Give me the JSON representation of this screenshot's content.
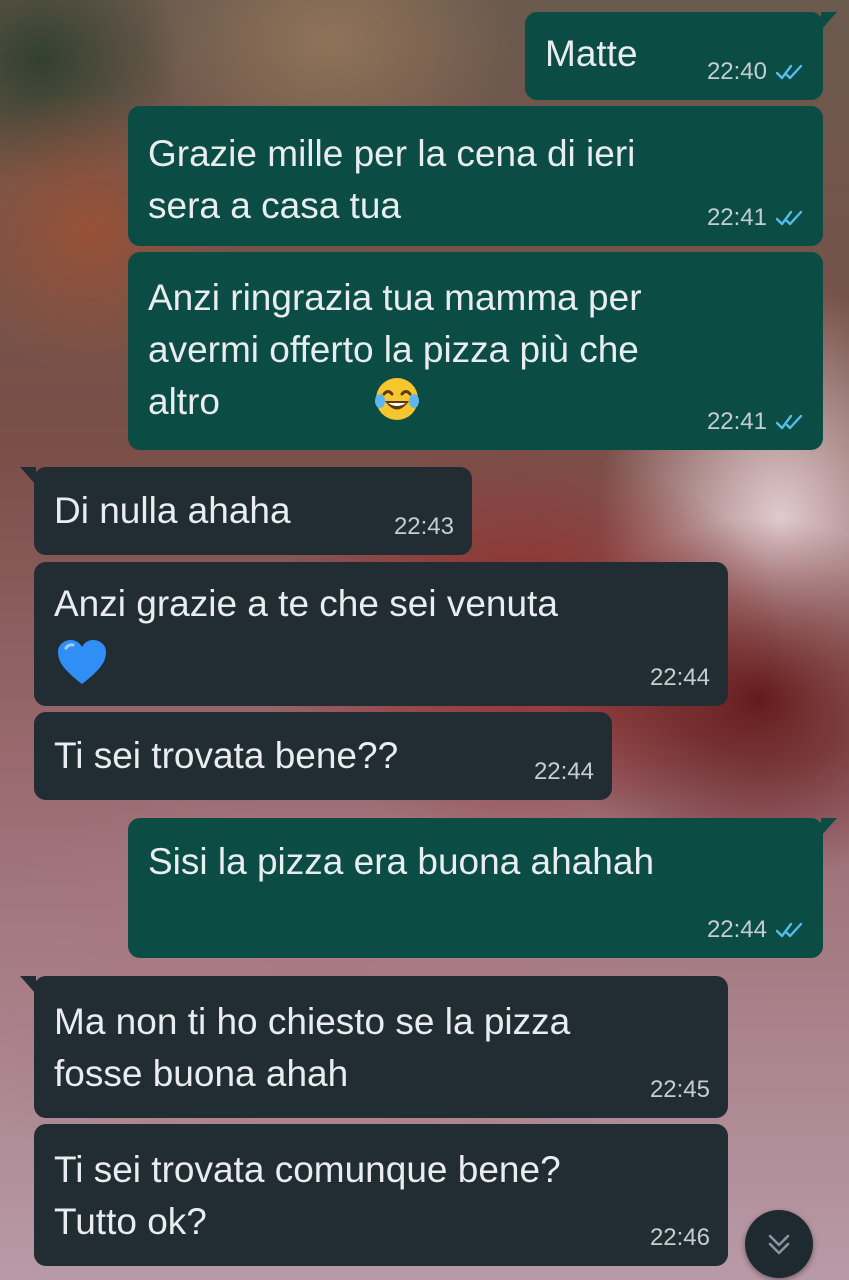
{
  "messages": [
    {
      "dir": "out",
      "text": "Matte",
      "time": "22:40",
      "read": true
    },
    {
      "dir": "out",
      "text": "Grazie mille per la cena di ieri\nsera a casa tua",
      "time": "22:41",
      "read": true
    },
    {
      "dir": "out",
      "text": "Anzi ringrazia tua mamma per\navermi offerto la pizza più che\naltro",
      "emoji": "face-with-tears-of-joy",
      "time": "22:41",
      "read": true
    },
    {
      "dir": "in",
      "text": "Di nulla ahaha",
      "time": "22:43"
    },
    {
      "dir": "in",
      "text": "Anzi grazie a te che sei venuta",
      "emoji": "blue-heart",
      "time": "22:44"
    },
    {
      "dir": "in",
      "text": "Ti sei trovata bene??",
      "time": "22:44"
    },
    {
      "dir": "out",
      "text": "Sisi la pizza era buona ahahah",
      "time": "22:44",
      "read": true
    },
    {
      "dir": "in",
      "text": "Ma non ti ho chiesto se la pizza\nfosse buona ahah",
      "time": "22:45"
    },
    {
      "dir": "in",
      "text": "Ti sei trovata comunque bene?\nTutto ok?",
      "time": "22:46"
    }
  ],
  "colors": {
    "outgoing_bubble": "#0b4d44",
    "incoming_bubble": "#212c33",
    "read_ticks": "#53bdeb",
    "text": "#e9edef",
    "timestamp": "#c5cdd1"
  },
  "scroll_button": {
    "icon": "double-chevron-down-icon"
  }
}
